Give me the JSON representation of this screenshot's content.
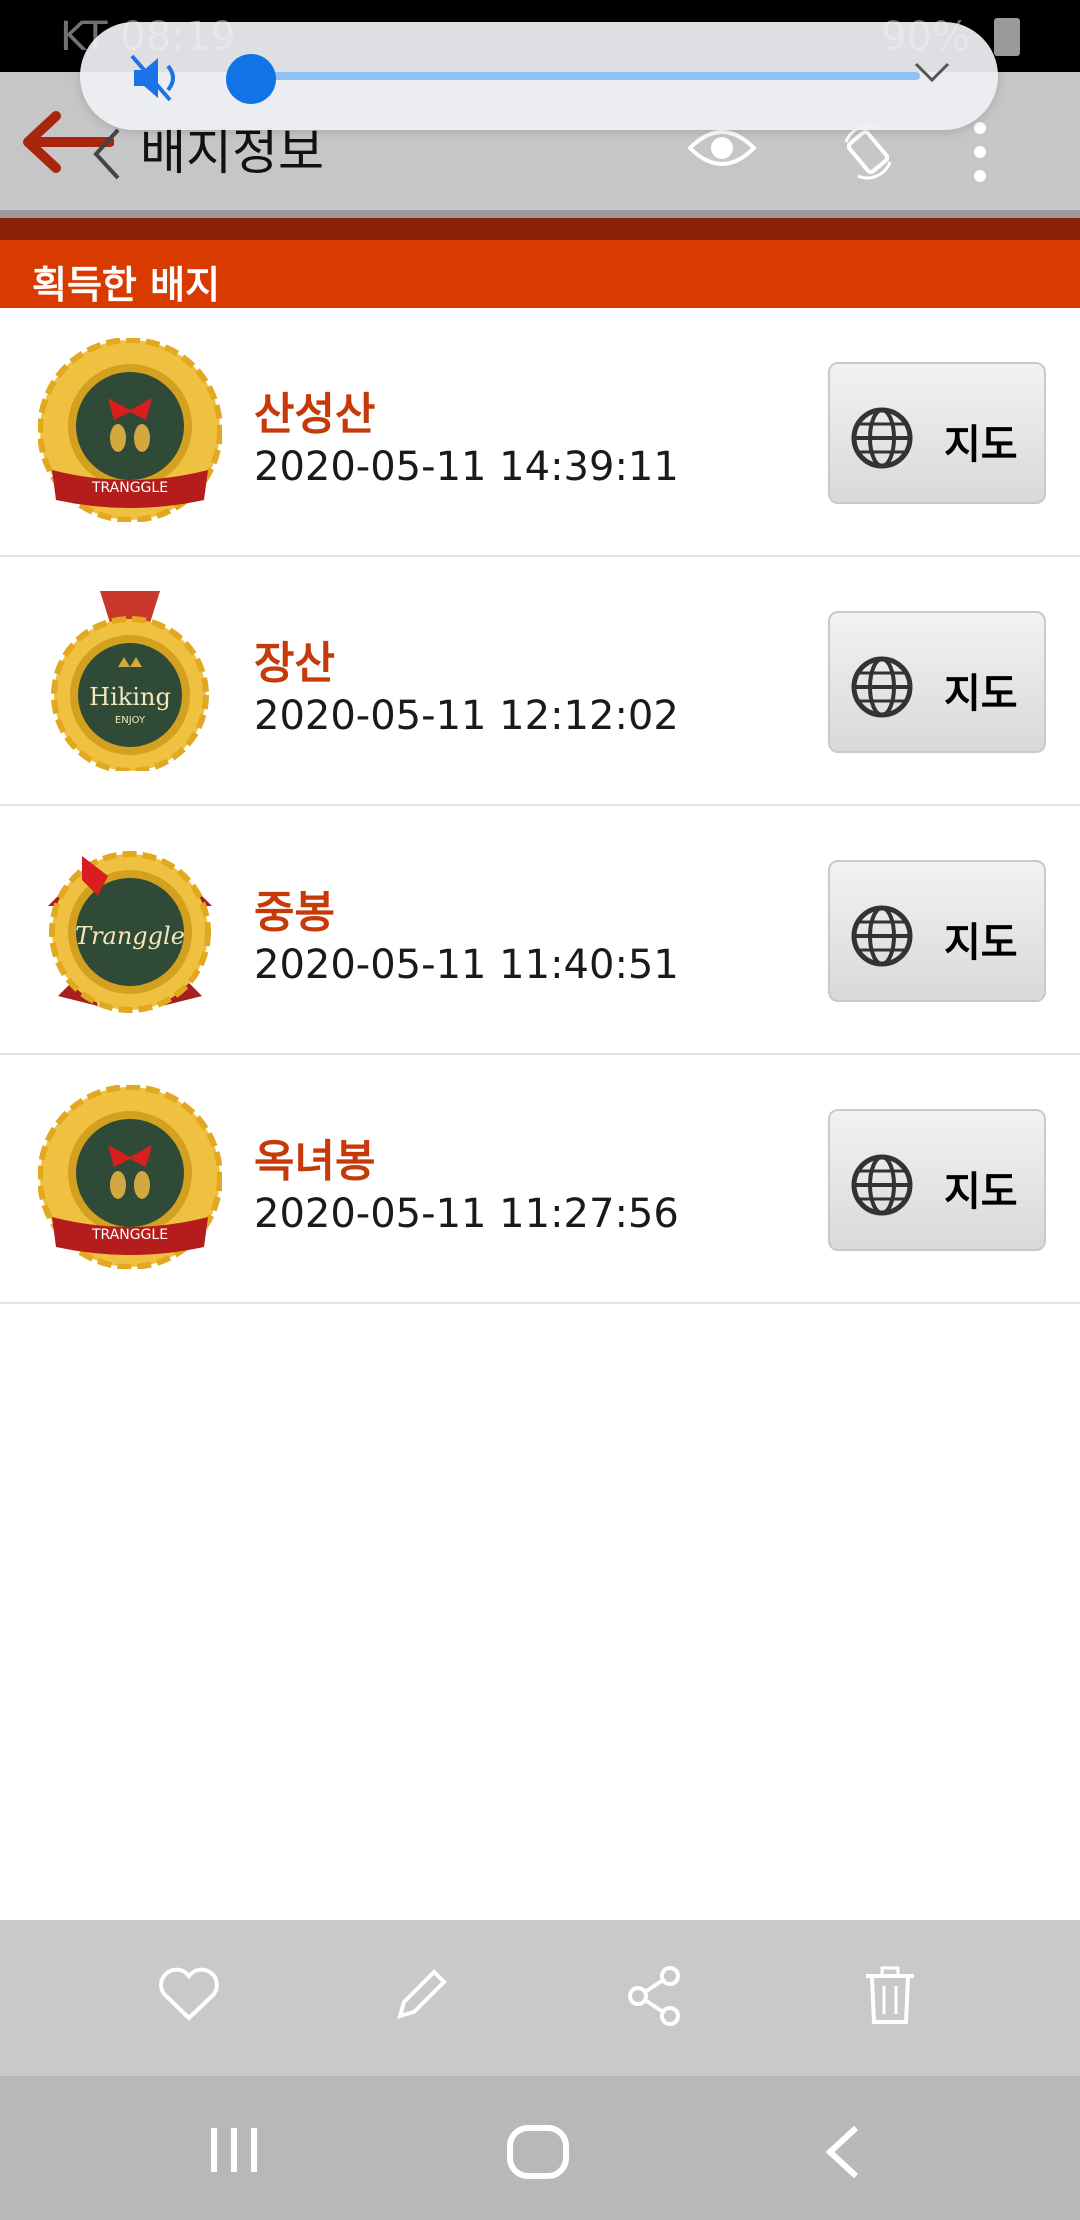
{
  "status_bar": {
    "left_text": "KT 08:19",
    "right_text": "90%"
  },
  "app_bar": {
    "title": "배지정보"
  },
  "section": {
    "title": "획득한 배지"
  },
  "badges": [
    {
      "name": "산성산",
      "time": "2020-05-11 14:39:11",
      "badge_style": "tranggle-feet",
      "map_label": "지도"
    },
    {
      "name": "장산",
      "time": "2020-05-11 12:12:02",
      "badge_style": "hiking-enjoy",
      "map_label": "지도"
    },
    {
      "name": "중봉",
      "time": "2020-05-11 11:40:51",
      "badge_style": "tranggle-script",
      "map_label": "지도"
    },
    {
      "name": "옥녀봉",
      "time": "2020-05-11 11:27:56",
      "badge_style": "tranggle-feet",
      "map_label": "지도"
    }
  ],
  "badge_text": {
    "tranggle": "TRANGGLE",
    "hiking": "Hiking",
    "enjoy": "ENJOY",
    "script": "Tranggle"
  },
  "icons": {
    "back": "back-arrow-icon",
    "eye": "eye-icon",
    "rotate": "rotate-icon",
    "more": "more-vertical-icon",
    "globe": "globe-icon",
    "favorite": "heart-icon",
    "edit": "pencil-icon",
    "share": "share-icon",
    "delete": "trash-icon"
  },
  "colors": {
    "accent": "#d83a00",
    "badge_name": "#c63a0a",
    "volume_knob": "#1174e6"
  }
}
